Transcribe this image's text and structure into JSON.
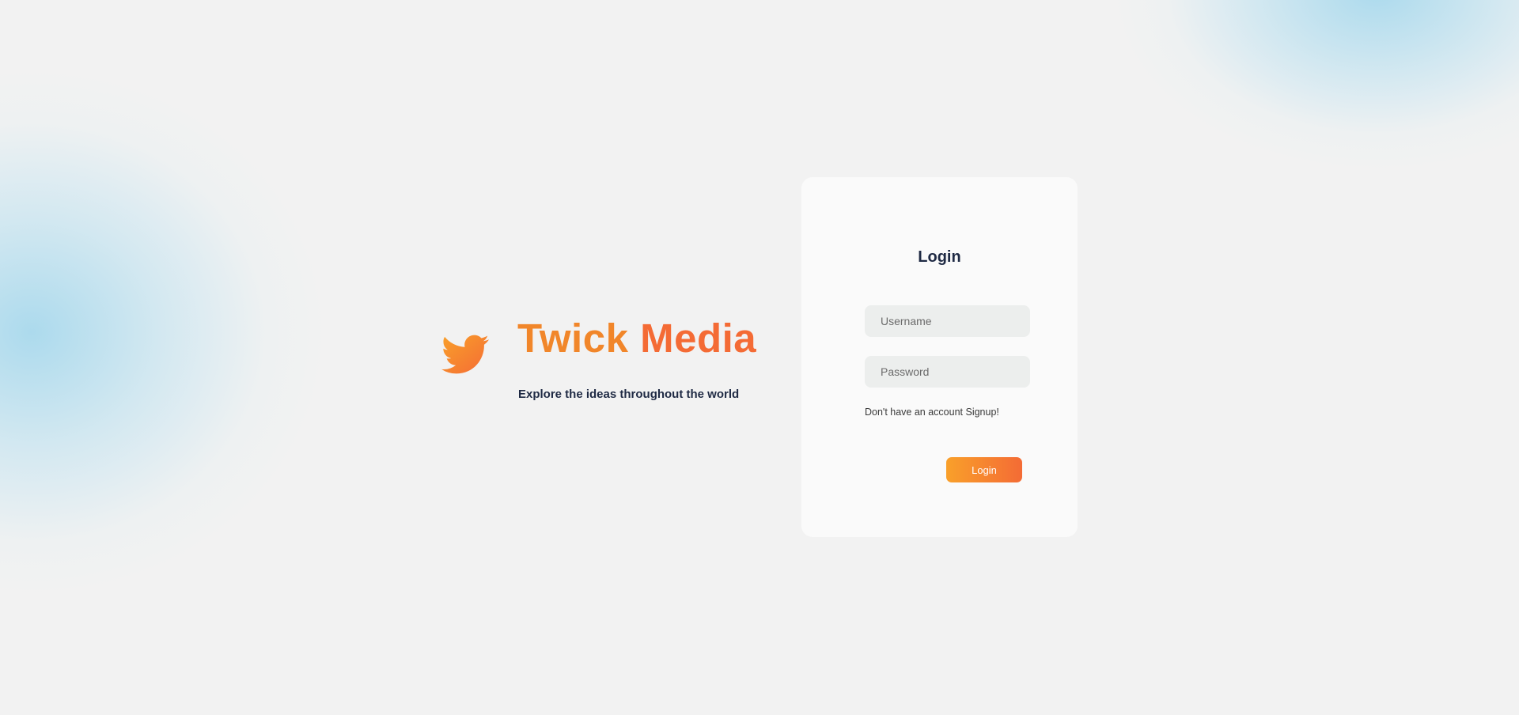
{
  "brand": {
    "name_part1": "Twick",
    "name_part2": "Media",
    "tagline": "Explore the ideas throughout the world",
    "logo_icon": "bird-icon",
    "gradient_start": "#f9a02a",
    "gradient_end": "#f46b35"
  },
  "login_form": {
    "title": "Login",
    "username_placeholder": "Username",
    "password_placeholder": "Password",
    "signup_prefix": "Don't have an account",
    "signup_link": "Signup!",
    "submit_label": "Login"
  },
  "colors": {
    "background": "#f2f2f2",
    "card": "#fafafa",
    "input": "#eceeed",
    "text_dark": "#1f2a44",
    "blob": "#a0d6ec"
  }
}
